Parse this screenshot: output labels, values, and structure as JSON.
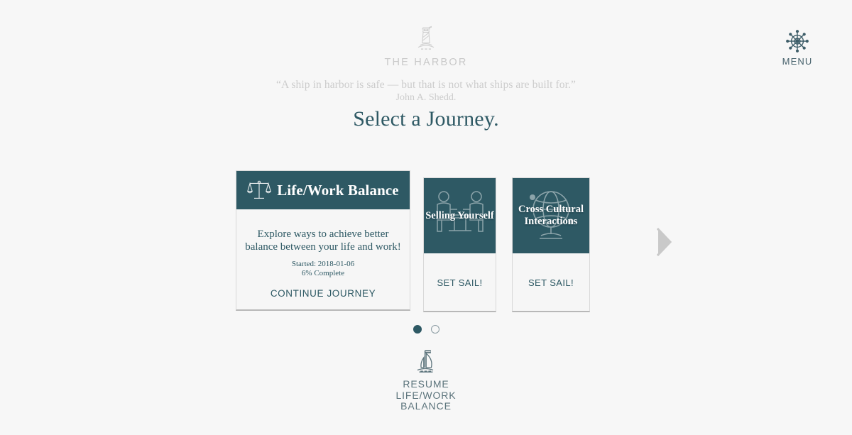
{
  "brand": {
    "icon": "lighthouse-icon",
    "name": "THE HARBOR"
  },
  "menu": {
    "icon": "ships-wheel-icon",
    "label": "MENU"
  },
  "quote": {
    "text": "“A ship in harbor is safe — but that is not what ships are built for.”",
    "author": "John A. Shedd."
  },
  "page_title": "Select a Journey.",
  "journeys": [
    {
      "title": "Life/Work Balance",
      "icon": "balance-scales-icon",
      "description": "Explore ways to achieve better balance between your life and work!",
      "started_label": "Started: 2018-01-06",
      "progress_label": "6% Complete",
      "action": "CONTINUE JOURNEY",
      "state": "in-progress"
    },
    {
      "title": "Selling Yourself",
      "icon": "interview-table-icon",
      "action": "SET SAIL!",
      "state": "not-started"
    },
    {
      "title": "Cross Cultural Interactions",
      "icon": "globe-stand-icon",
      "action": "SET SAIL!",
      "state": "not-started"
    }
  ],
  "carousel": {
    "next_icon": "chevron-right-icon",
    "dots": [
      {
        "active": true
      },
      {
        "active": false
      }
    ]
  },
  "resume": {
    "icon": "sailboat-icon",
    "label": "RESUME LIFE/WORK BALANCE",
    "line1": "RESUME",
    "line2": "LIFE/WORK",
    "line3": "BALANCE"
  },
  "colors": {
    "teal": "#2e5964",
    "background": "#f7f7f7",
    "muted_text": "#cccccc",
    "card_border": "#d8d8d8",
    "arrow_gray": "#c4c4c4"
  }
}
